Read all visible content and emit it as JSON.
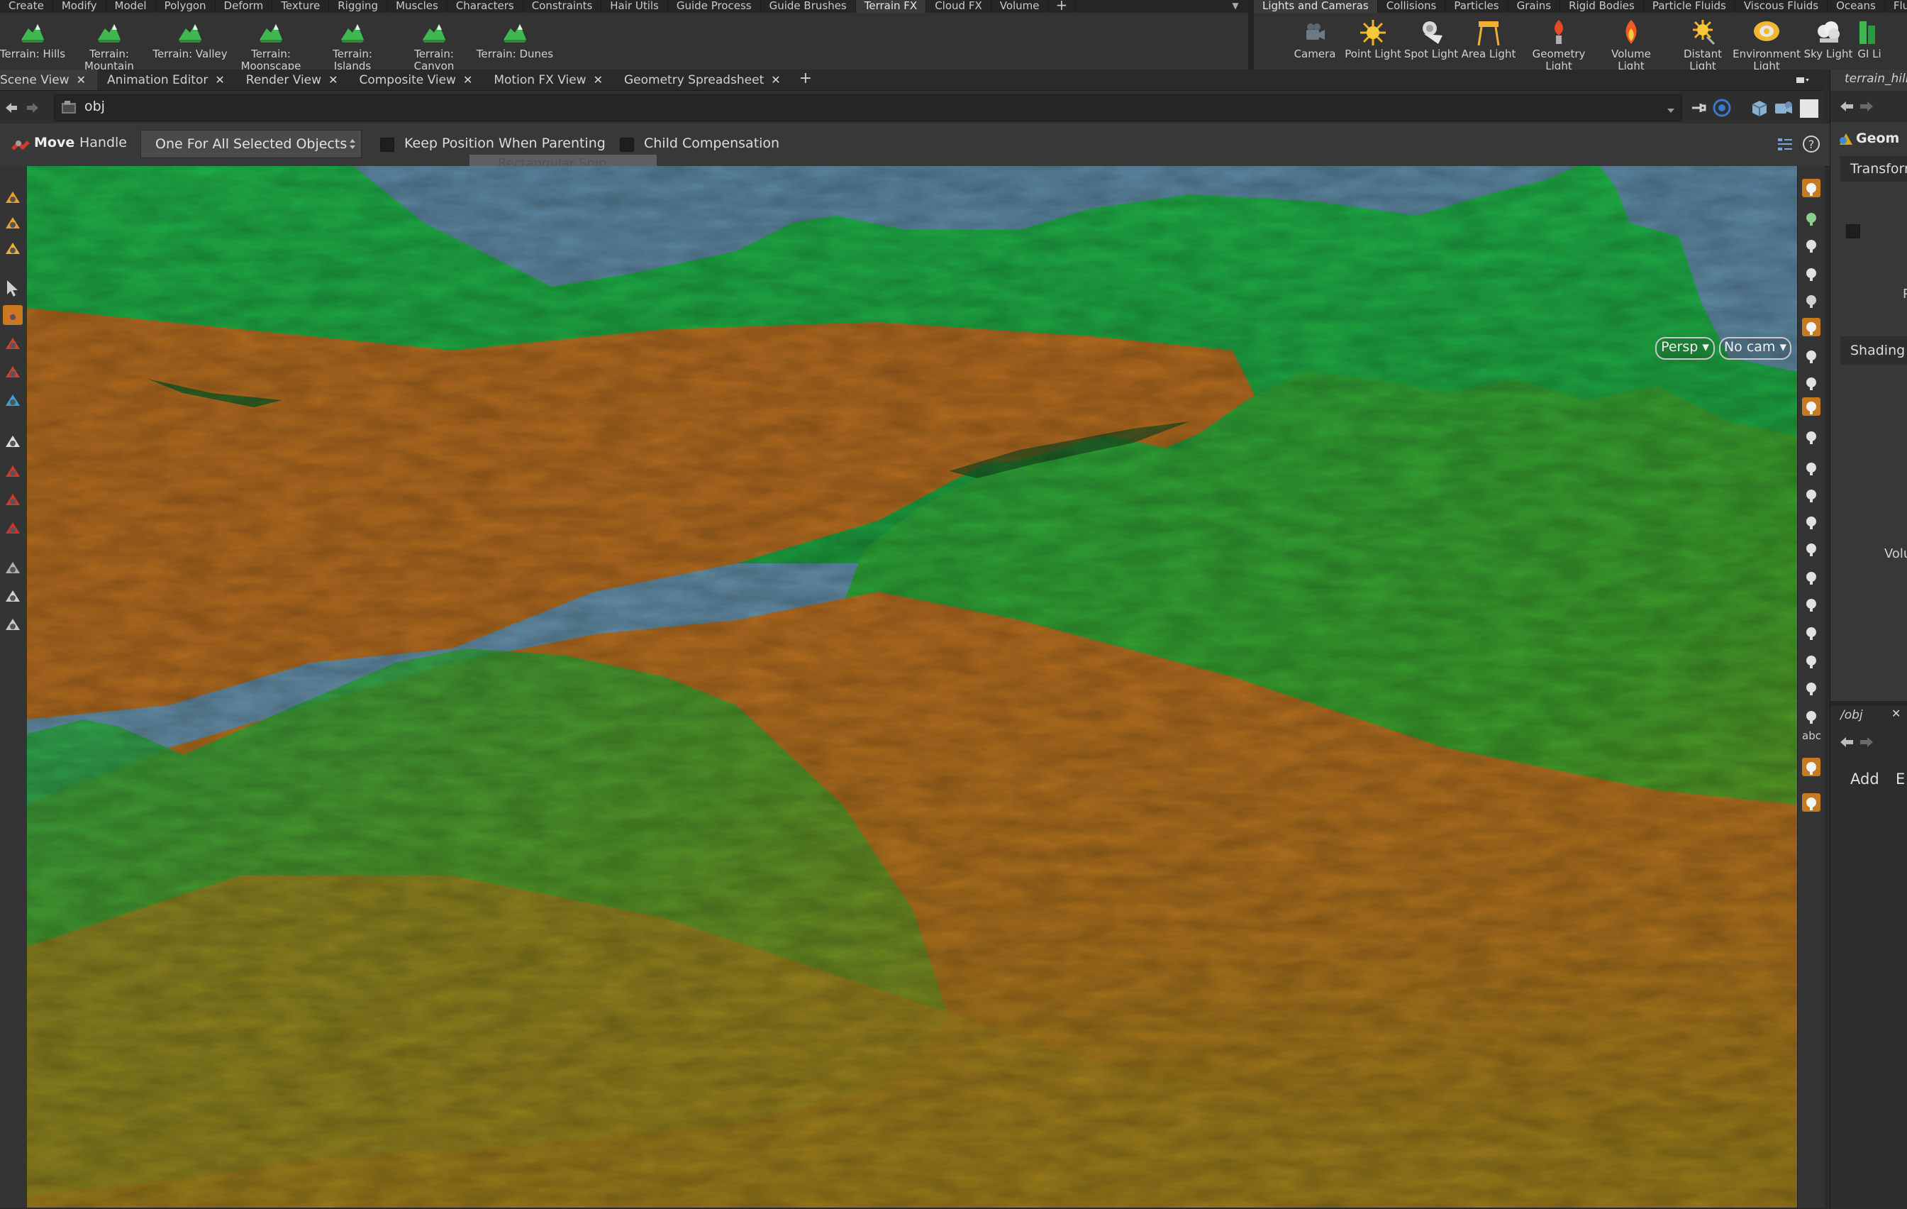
{
  "shelf": {
    "left_tabs": [
      "Create",
      "Modify",
      "Model",
      "Polygon",
      "Deform",
      "Texture",
      "Rigging",
      "Muscles",
      "Characters",
      "Constraints",
      "Hair Utils",
      "Guide Process",
      "Guide Brushes",
      "Terrain FX",
      "Cloud FX",
      "Volume"
    ],
    "left_active": "Terrain FX",
    "right_tabs": [
      "Lights and Cameras",
      "Collisions",
      "Particles",
      "Grains",
      "Rigid Bodies",
      "Particle Fluids",
      "Viscous Fluids",
      "Oceans",
      "Fluid"
    ],
    "right_active": "Lights and Cameras",
    "left_tools": [
      {
        "l1": "Terrain: Hills",
        "l2": ""
      },
      {
        "l1": "Terrain:",
        "l2": "Mountain"
      },
      {
        "l1": "Terrain: Valley",
        "l2": ""
      },
      {
        "l1": "Terrain:",
        "l2": "Moonscape"
      },
      {
        "l1": "Terrain:",
        "l2": "Islands"
      },
      {
        "l1": "Terrain:",
        "l2": "Canyon"
      },
      {
        "l1": "Terrain: Dunes",
        "l2": ""
      }
    ],
    "right_tools": [
      {
        "l1": "Camera",
        "l2": "",
        "icon": "camera-icon"
      },
      {
        "l1": "Point Light",
        "l2": "",
        "icon": "point-light-icon"
      },
      {
        "l1": "Spot Light",
        "l2": "",
        "icon": "spot-light-icon"
      },
      {
        "l1": "Area Light",
        "l2": "",
        "icon": "area-light-icon"
      },
      {
        "l1": "Geometry",
        "l2": "Light",
        "icon": "geometry-light-icon"
      },
      {
        "l1": "Volume Light",
        "l2": "",
        "icon": "volume-light-icon"
      },
      {
        "l1": "Distant Light",
        "l2": "",
        "icon": "distant-light-icon"
      },
      {
        "l1": "Environment",
        "l2": "Light",
        "icon": "environment-light-icon"
      },
      {
        "l1": "Sky Light",
        "l2": "",
        "icon": "sky-light-icon"
      },
      {
        "l1": "GI Li",
        "l2": "",
        "icon": "gi-light-icon"
      }
    ]
  },
  "pane_tabs": [
    "Scene View",
    "Animation Editor",
    "Render View",
    "Composite View",
    "Motion FX View",
    "Geometry Spreadsheet"
  ],
  "path": {
    "network": "obj"
  },
  "op_bar": {
    "tool_name": "Move",
    "handle_label": "Handle",
    "mode_select": "One For All Selected Objects",
    "keep_position": "Keep Position When Parenting",
    "child_comp": "Child Compensation",
    "ghost_text": "Rectangular Snip"
  },
  "viewport": {
    "persp_label": "Persp",
    "cam_label": "No cam",
    "colors": {
      "sky": "#5f8aa0",
      "terrain_high": "#1fa33c",
      "terrain_low": "#b86e1c"
    }
  },
  "right_toolbar": {
    "abc_label": "abc"
  },
  "right_panel": {
    "node_name": "terrain_hills",
    "tab_label": "Geom",
    "section1": "Transform",
    "section2": "Shading",
    "frag_p": "P",
    "frag_vol": "Volu",
    "network_path": "/obj",
    "add_label": "Add",
    "edit_frag": "E"
  },
  "accent": "#f0a020"
}
